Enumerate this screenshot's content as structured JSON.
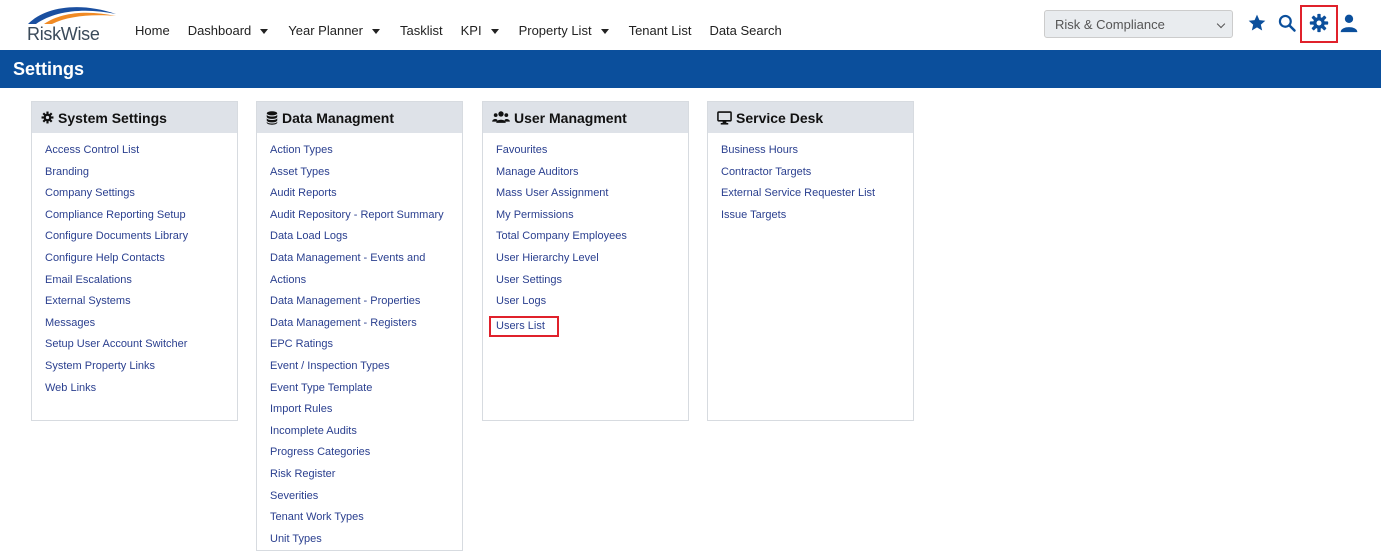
{
  "header": {
    "logo_text": "RiskWise",
    "nav": [
      {
        "label": "Home",
        "caret": false
      },
      {
        "label": "Dashboard",
        "caret": true
      },
      {
        "label": "Year Planner",
        "caret": true
      },
      {
        "label": "Tasklist",
        "caret": false
      },
      {
        "label": "KPI",
        "caret": true
      },
      {
        "label": "Property List",
        "caret": true
      },
      {
        "label": "Tenant List",
        "caret": false
      },
      {
        "label": "Data Search",
        "caret": false
      }
    ],
    "role_select": "Risk & Compliance",
    "icons": [
      "star-icon",
      "search-icon",
      "gear-icon",
      "user-icon"
    ]
  },
  "banner": {
    "title": "Settings"
  },
  "panels": [
    {
      "title": "System Settings",
      "icon": "gear-icon",
      "links": [
        "Access Control List",
        "Branding",
        "Company Settings",
        "Compliance Reporting Setup",
        "Configure Documents Library",
        "Configure Help Contacts",
        "Email Escalations",
        "External Systems",
        "Messages",
        "Setup User Account Switcher",
        "System Property Links",
        "Web Links"
      ]
    },
    {
      "title": "Data Managment",
      "icon": "database-icon",
      "links": [
        "Action Types",
        "Asset Types",
        "Audit Reports",
        "Audit Repository - Report Summary",
        "Data Load Logs",
        "Data Management - Events and",
        "Actions",
        "Data Management - Properties",
        "Data Management - Registers",
        "EPC Ratings",
        "Event / Inspection Types",
        "Event Type Template",
        "Import Rules",
        "Incomplete Audits",
        "Progress Categories",
        "Risk Register",
        "Severities",
        "Tenant Work Types",
        "Unit Types"
      ]
    },
    {
      "title": "User Managment",
      "icon": "users-icon",
      "links": [
        "Favourites",
        "Manage Auditors",
        "Mass User Assignment",
        "My Permissions",
        "Total Company Employees",
        "User Hierarchy Level",
        "User Settings",
        "User Logs",
        "Users List"
      ]
    },
    {
      "title": "Service Desk",
      "icon": "desktop-icon",
      "links": [
        "Business Hours",
        "Contractor Targets",
        "External Service Requester List",
        "Issue Targets"
      ]
    }
  ],
  "colors": {
    "brand": "#0b4f9c",
    "link": "#2a3f8f",
    "highlight": "#e0212b"
  }
}
